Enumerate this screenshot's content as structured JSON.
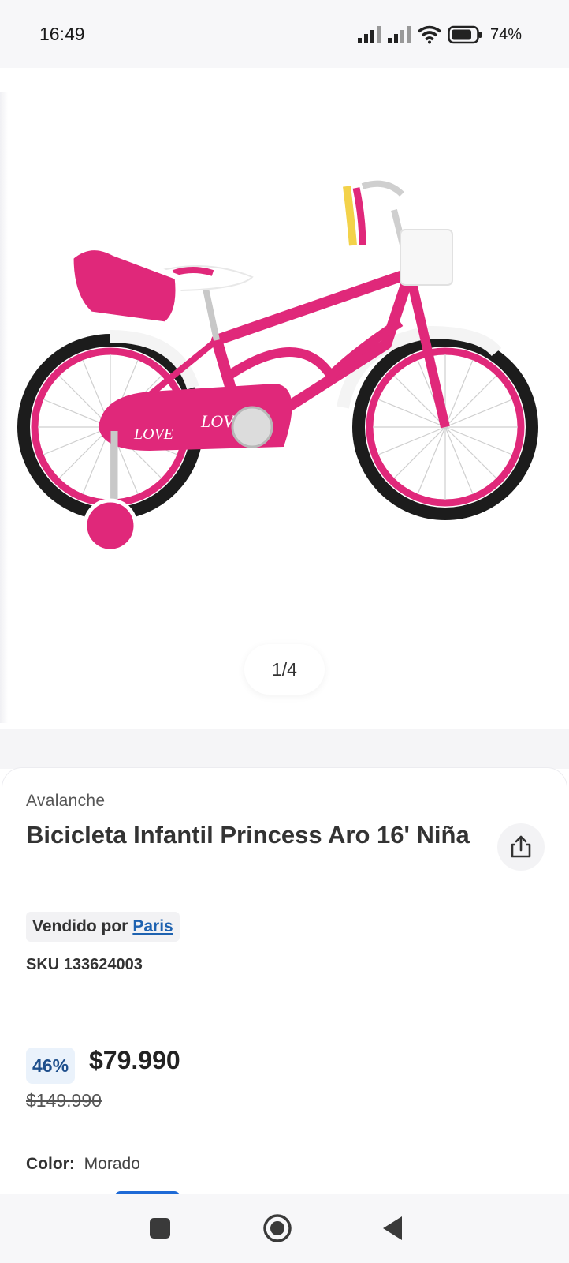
{
  "status_bar": {
    "time": "16:49",
    "battery": "74%"
  },
  "gallery": {
    "pager": "1/4",
    "accent": "#e0287a"
  },
  "product": {
    "brand": "Avalanche",
    "title": "Bicicleta Infantil Princess Aro 16' Niña",
    "seller_label": "Vendido por",
    "seller_name": "Paris",
    "sku": "SKU 133624003",
    "discount": "46%",
    "price": "$79.990",
    "old_price": "$149.990",
    "color_label": "Color:",
    "color_value": "Morado"
  },
  "icons": [
    "signal-icon",
    "wifi-icon",
    "battery-icon",
    "share-icon",
    "recents-icon",
    "home-icon",
    "back-icon"
  ]
}
